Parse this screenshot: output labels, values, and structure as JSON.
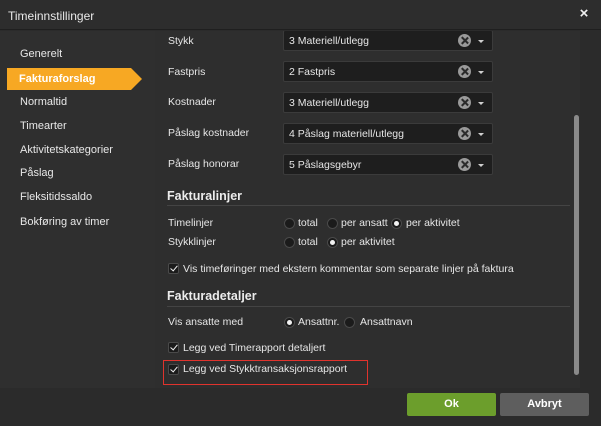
{
  "window": {
    "title": "Timeinnstillinger",
    "close_glyph": "×"
  },
  "sidebar": {
    "items": [
      {
        "label": "Generelt"
      },
      {
        "label": "Fakturaforslag",
        "active": true
      },
      {
        "label": "Normaltid"
      },
      {
        "label": "Timearter"
      },
      {
        "label": "Aktivitetskategorier"
      },
      {
        "label": "Påslag"
      },
      {
        "label": "Fleksitidssaldo"
      },
      {
        "label": "Bokføring av timer"
      }
    ]
  },
  "fields": [
    {
      "label": "Stykk",
      "value": "3 Materiell/utlegg"
    },
    {
      "label": "Fastpris",
      "value": "2 Fastpris"
    },
    {
      "label": "Kostnader",
      "value": "3 Materiell/utlegg"
    },
    {
      "label": "Påslag kostnader",
      "value": "4 Påslag materiell/utlegg"
    },
    {
      "label": "Påslag honorar",
      "value": "5 Påslagsgebyr"
    }
  ],
  "fakturalinjer": {
    "heading": "Fakturalinjer",
    "timelinjer": {
      "label": "Timelinjer",
      "options": [
        "total",
        "per ansatt",
        "per aktivitet"
      ],
      "selected": "per aktivitet"
    },
    "stykklinjer": {
      "label": "Stykklinjer",
      "options": [
        "total",
        "per aktivitet"
      ],
      "selected": "per aktivitet"
    },
    "vis_timeforinger": {
      "label": "Vis timeføringer med ekstern kommentar som separate linjer på faktura",
      "checked": true
    }
  },
  "fakturadetaljer": {
    "heading": "Fakturadetaljer",
    "vis_ansatte": {
      "label": "Vis ansatte med",
      "options": [
        "Ansattnr.",
        "Ansattnavn"
      ],
      "selected": "Ansattnr."
    },
    "legg_timerapport": {
      "label": "Legg ved Timerapport detaljert",
      "checked": true
    },
    "legg_stykk": {
      "label": "Legg ved Stykktransaksjonsrapport",
      "checked": true
    }
  },
  "buttons": {
    "ok": "Ok",
    "cancel": "Avbryt"
  },
  "colors": {
    "accent": "#f7a823",
    "ok": "#6c9e2c",
    "cancel": "#5e5e5e",
    "highlight": "#e0332d"
  }
}
